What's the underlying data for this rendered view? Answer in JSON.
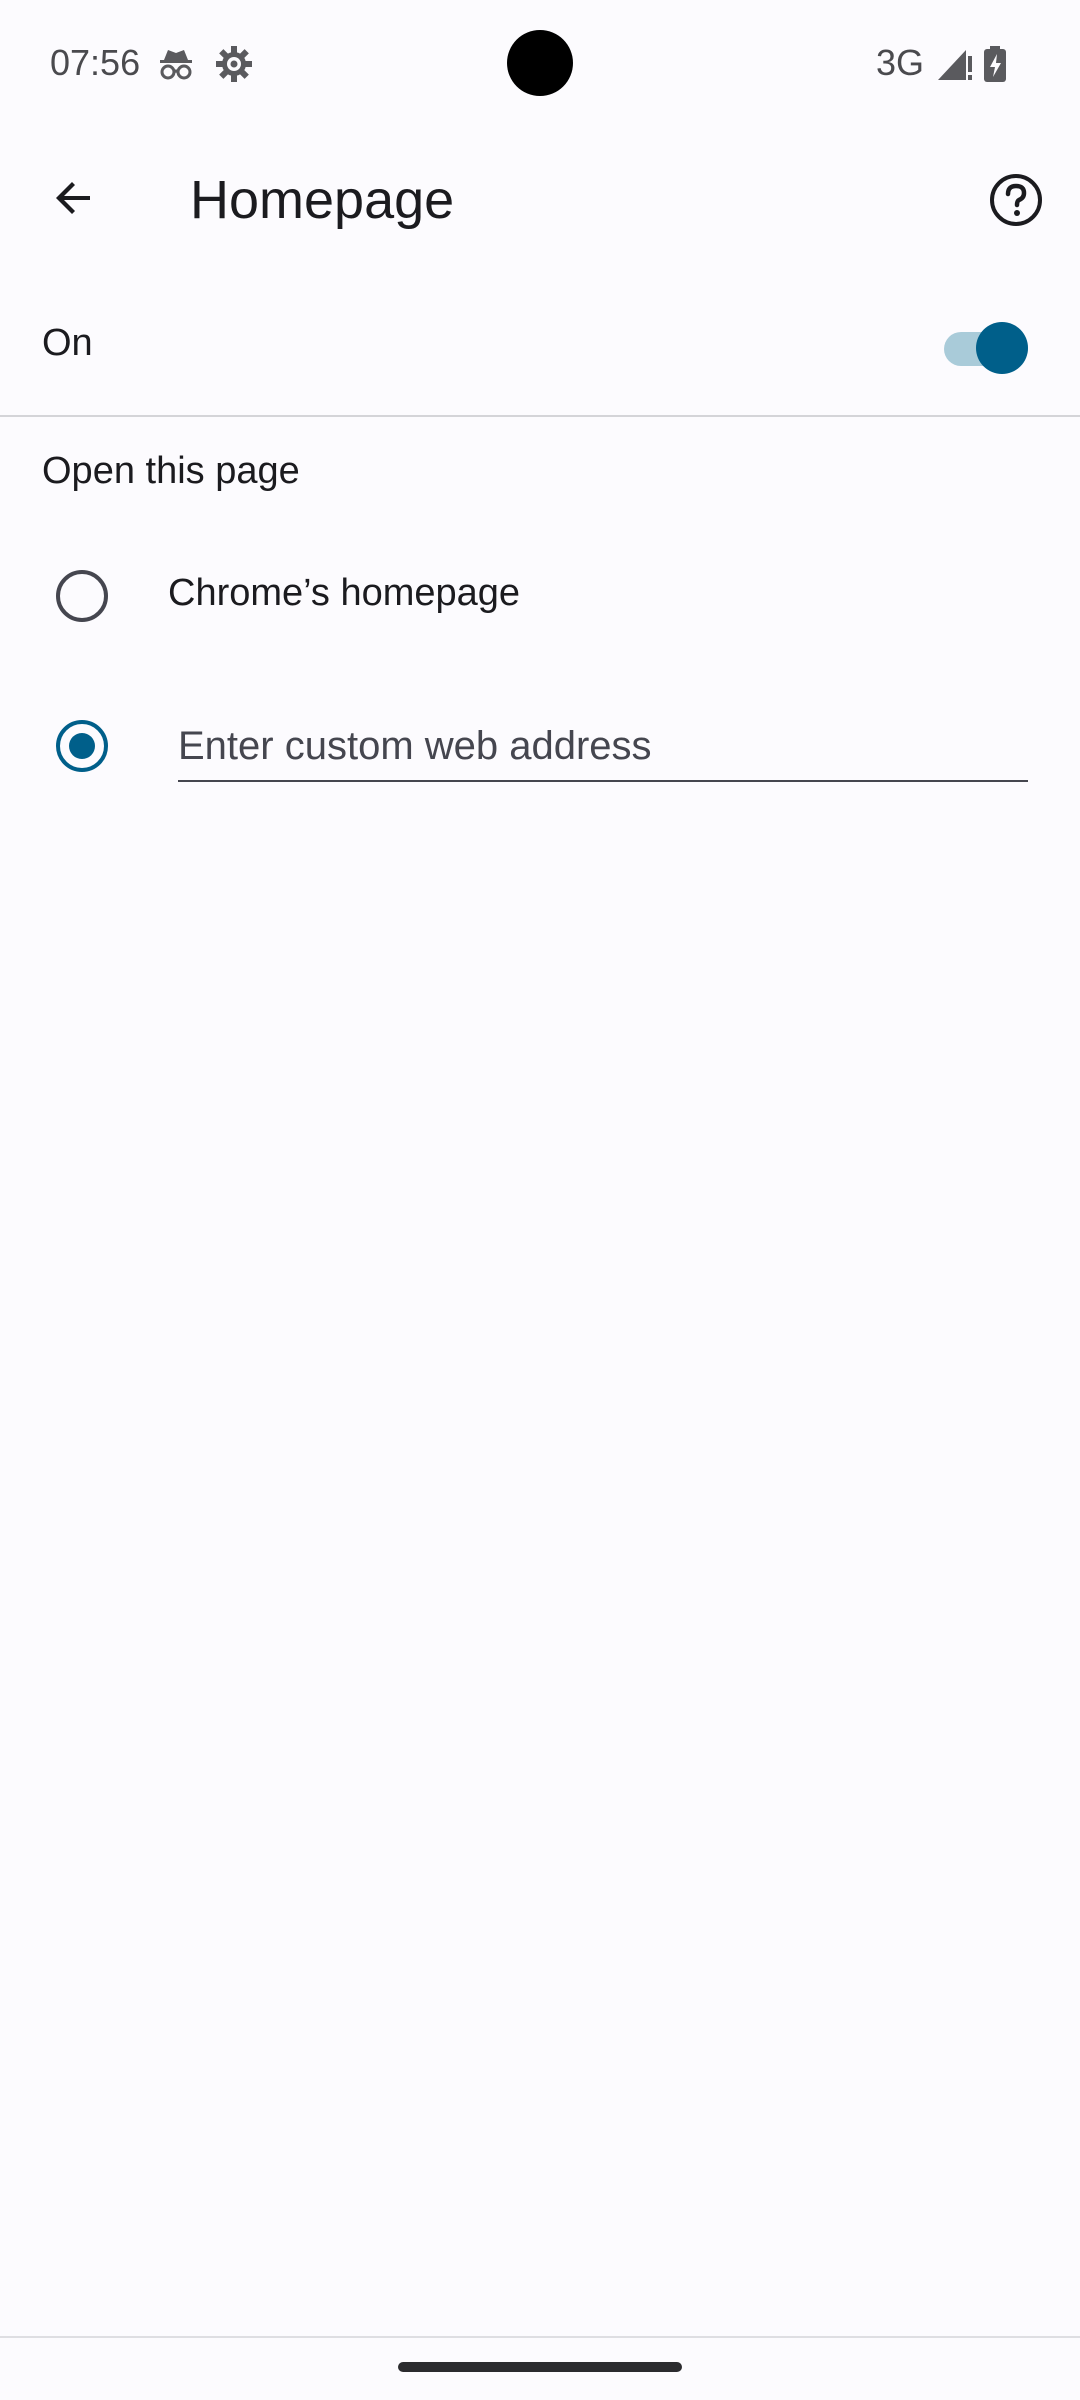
{
  "status_bar": {
    "time": "07:56",
    "icons": [
      "incognito-icon",
      "settings-gear-icon"
    ],
    "network": "3G",
    "signal_icon": "signal-icon",
    "battery_icon": "battery-charging-icon"
  },
  "app_bar": {
    "title": "Homepage",
    "back_icon": "arrow-back-icon",
    "help_icon": "help-circle-icon"
  },
  "homepage_toggle": {
    "label": "On",
    "enabled": true
  },
  "open_page_section": {
    "header": "Open this page",
    "options": [
      {
        "label": "Chrome’s homepage",
        "selected": false
      },
      {
        "placeholder": "Enter custom web address",
        "value": "",
        "selected": true
      }
    ]
  },
  "colors": {
    "accent": "#005f8a",
    "track": "#a9cbd9",
    "background": "#fcfbfe"
  }
}
